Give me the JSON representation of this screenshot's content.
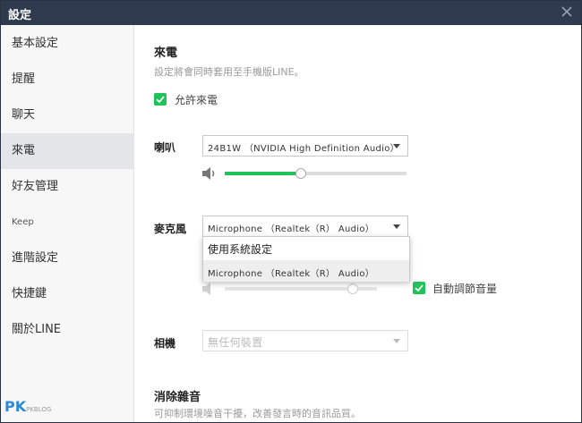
{
  "window": {
    "title": "設定"
  },
  "sidebar": {
    "items": [
      {
        "label": "基本設定"
      },
      {
        "label": "提醒"
      },
      {
        "label": "聊天"
      },
      {
        "label": "來電"
      },
      {
        "label": "好友管理"
      },
      {
        "label": "Keep"
      },
      {
        "label": "進階設定"
      },
      {
        "label": "快捷鍵"
      },
      {
        "label": "關於LINE"
      }
    ],
    "active_index": 3
  },
  "main": {
    "call_title": "來電",
    "call_desc": "設定將會同時套用至手機版LINE。",
    "allow_calls": {
      "label": "允許來電",
      "checked": true
    },
    "speaker": {
      "label": "喇叭",
      "selected": "24B1W （NVIDIA  High  Definition  Audio）",
      "volume_fraction": 0.42
    },
    "microphone": {
      "label": "麥克風",
      "selected": "Microphone （Realtek（R） Audio）",
      "options": [
        "使用系統設定",
        "Microphone （Realtek（R） Audio）"
      ],
      "volume_fraction": 0.84,
      "auto_adjust": {
        "label": "自動調節音量",
        "checked": true
      }
    },
    "camera": {
      "label": "相機",
      "selected": "無任何裝置"
    },
    "noise": {
      "title": "消除雜音",
      "desc": "可抑制環境噪音干擾，改善發言時的音訊品質。"
    }
  },
  "watermark": {
    "main": "PK",
    "sub": "PKBLOG"
  },
  "colors": {
    "accent": "#1fc359",
    "titlebar": "#2e3a4d",
    "sidebar_active": "#e3e5e8"
  }
}
